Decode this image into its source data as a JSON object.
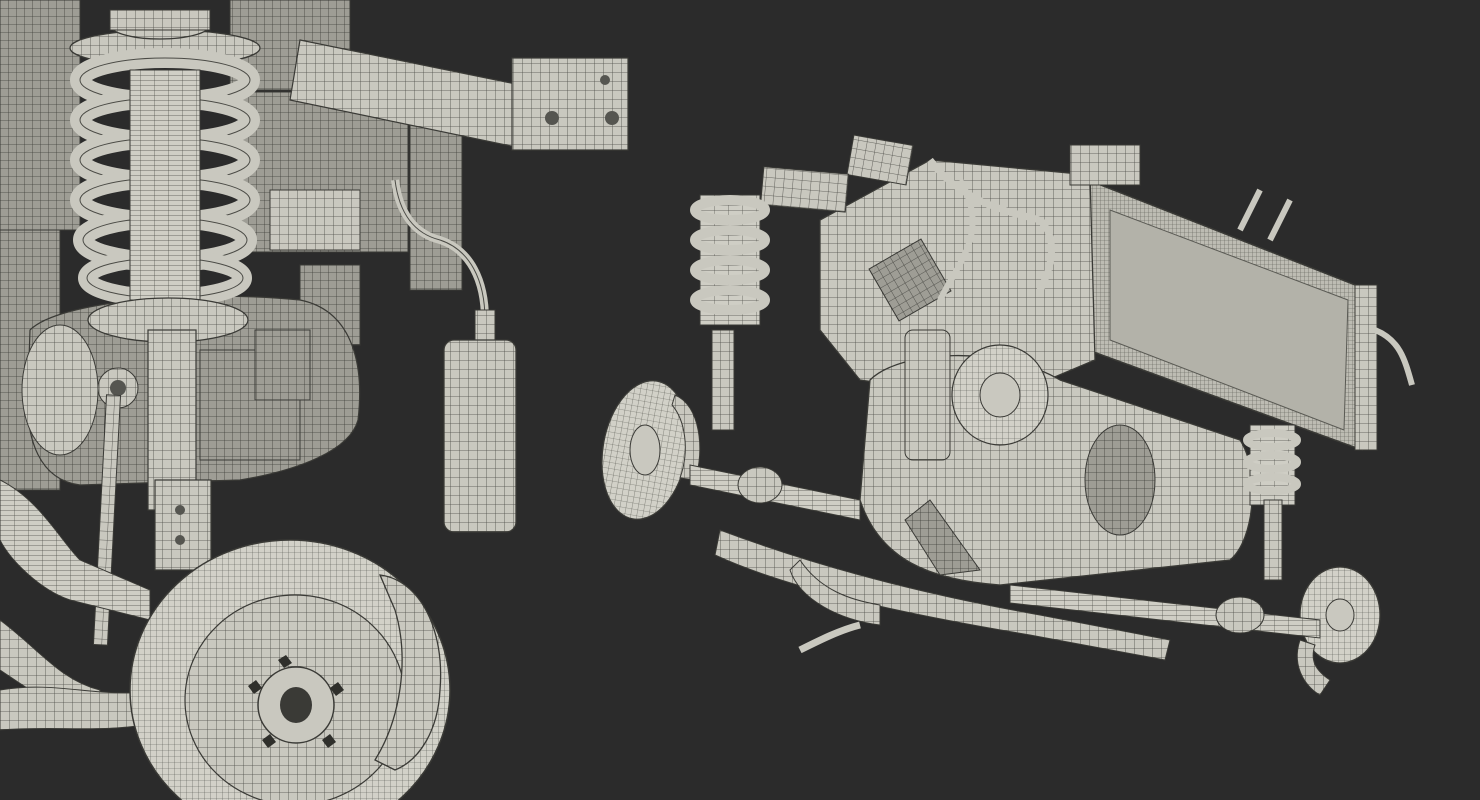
{
  "scene": {
    "background": "#2b2b2b",
    "surface_light": "#d9d8cf",
    "surface_mid": "#a9a89f",
    "surface_dark": "#6f6e68",
    "wire": "#44443f",
    "components_left": [
      "coil-spring",
      "shock-absorber",
      "strut-mount",
      "control-arm",
      "brake-disc",
      "brake-caliper",
      "drive-shaft",
      "fluid-canister"
    ],
    "components_right": [
      "engine-block",
      "radiator",
      "gearbox",
      "brake-disc-left",
      "brake-disc-right",
      "coil-spring-left",
      "coil-spring-right",
      "drive-shaft",
      "subframe"
    ]
  }
}
